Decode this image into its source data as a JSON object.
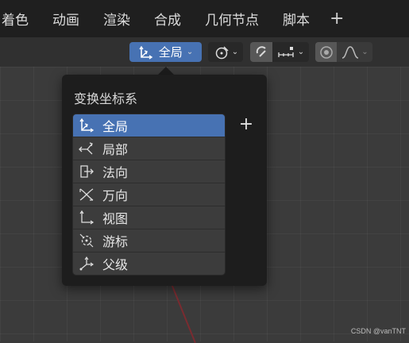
{
  "menu": {
    "tabs": [
      "着色",
      "动画",
      "渲染",
      "合成",
      "几何节点",
      "脚本"
    ],
    "add_label": "+"
  },
  "header": {
    "orientation_value": "全局",
    "accent_color": "#4772b3"
  },
  "popover": {
    "title": "变换坐标系",
    "add_label": "+",
    "items": [
      {
        "label": "全局",
        "icon": "global-orientation-icon",
        "selected": true
      },
      {
        "label": "局部",
        "icon": "local-orientation-icon",
        "selected": false
      },
      {
        "label": "法向",
        "icon": "normal-orientation-icon",
        "selected": false
      },
      {
        "label": "万向",
        "icon": "gimbal-orientation-icon",
        "selected": false
      },
      {
        "label": "视图",
        "icon": "view-orientation-icon",
        "selected": false
      },
      {
        "label": "游标",
        "icon": "cursor-orientation-icon",
        "selected": false
      },
      {
        "label": "父级",
        "icon": "parent-orientation-icon",
        "selected": false
      }
    ]
  },
  "watermark": "CSDN @vanTNT"
}
